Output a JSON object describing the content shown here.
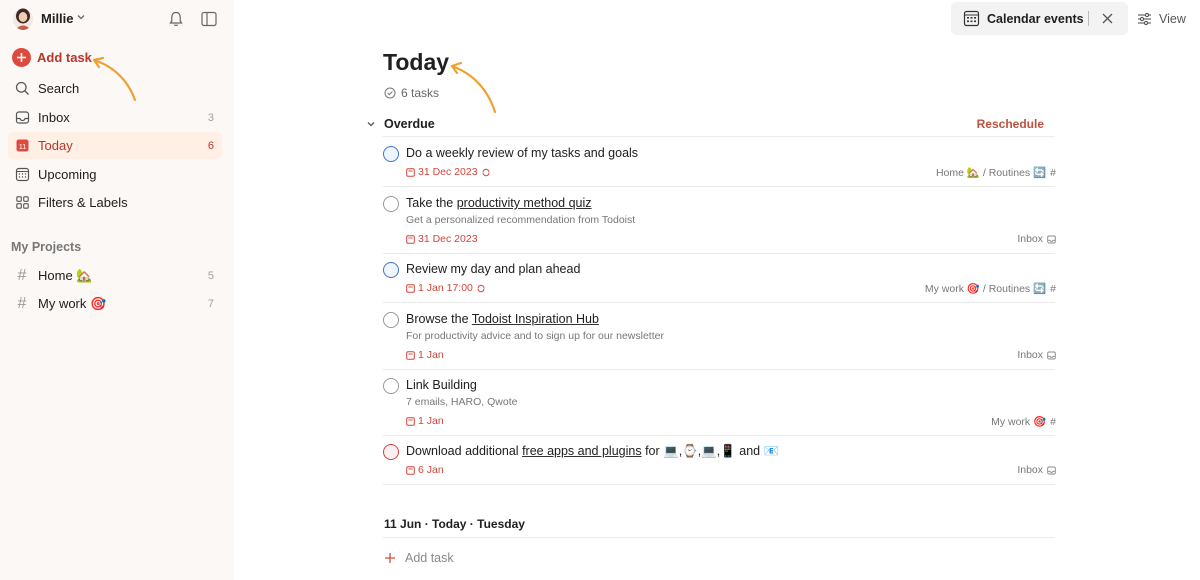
{
  "user": {
    "name": "Millie"
  },
  "sidebar": {
    "add_task_label": "Add task",
    "nav": [
      {
        "label": "Search",
        "icon": "search-icon",
        "count": ""
      },
      {
        "label": "Inbox",
        "icon": "inbox-icon",
        "count": "3"
      },
      {
        "label": "Today",
        "icon": "today-calendar-icon",
        "count": "6",
        "active": true
      },
      {
        "label": "Upcoming",
        "icon": "upcoming-calendar-icon",
        "count": ""
      },
      {
        "label": "Filters & Labels",
        "icon": "filters-grid-icon",
        "count": ""
      }
    ],
    "projects_header": "My Projects",
    "projects": [
      {
        "label": "Home 🏡",
        "count": "5"
      },
      {
        "label": "My work 🎯",
        "count": "7"
      }
    ]
  },
  "toolbar": {
    "calendar_events_label": "Calendar events",
    "view_label": "View"
  },
  "main": {
    "title": "Today",
    "task_count": "6 tasks",
    "overdue_label": "Overdue",
    "reschedule_label": "Reschedule",
    "tasks": [
      {
        "title_pre": "Do a weekly review of my tasks and goals",
        "link": "",
        "title_post": "",
        "description": "",
        "date": "31 Dec 2023",
        "recurring": true,
        "project": "Home 🏡 / Routines 🔄",
        "project_icon": "hash-icon",
        "priority": "p2"
      },
      {
        "title_pre": "Take the ",
        "link": "productivity method quiz",
        "title_post": "",
        "description": "Get a personalized recommendation from Todoist",
        "date": "31 Dec 2023",
        "recurring": false,
        "project": "Inbox",
        "project_icon": "inbox-icon",
        "priority": "p4"
      },
      {
        "title_pre": "Review my day and plan ahead",
        "link": "",
        "title_post": "",
        "description": "",
        "date": "1 Jan 17:00",
        "recurring": true,
        "project": "My work 🎯 / Routines 🔄",
        "project_icon": "hash-icon",
        "priority": "p2"
      },
      {
        "title_pre": "Browse the ",
        "link": "Todoist Inspiration Hub",
        "title_post": "",
        "description": "For productivity advice and to sign up for our newsletter",
        "date": "1 Jan",
        "recurring": false,
        "project": "Inbox",
        "project_icon": "inbox-icon",
        "priority": "p4"
      },
      {
        "title_pre": "Link Building",
        "link": "",
        "title_post": "",
        "description": "7 emails, HARO, Qwote",
        "date": "1 Jan",
        "recurring": false,
        "project": "My work 🎯",
        "project_icon": "hash-icon",
        "priority": "p4"
      },
      {
        "title_pre": "Download additional ",
        "link": "free apps and plugins",
        "title_post": " for 💻,⌚,💻,📱 and 📧",
        "description": "",
        "date": "6 Jan",
        "recurring": false,
        "project": "Inbox",
        "project_icon": "inbox-icon",
        "priority": "p1"
      }
    ],
    "day_header": "11 Jun · Today · Tuesday",
    "add_task_inline": "Add task"
  },
  "colors": {
    "accent": "#dc4c3e",
    "accent_text": "#b8352a",
    "sidebar_bg": "#fcf8f5",
    "active_bg": "#ffefe5",
    "overdue_date": "#d1453b",
    "arrow": "#f0a030"
  }
}
